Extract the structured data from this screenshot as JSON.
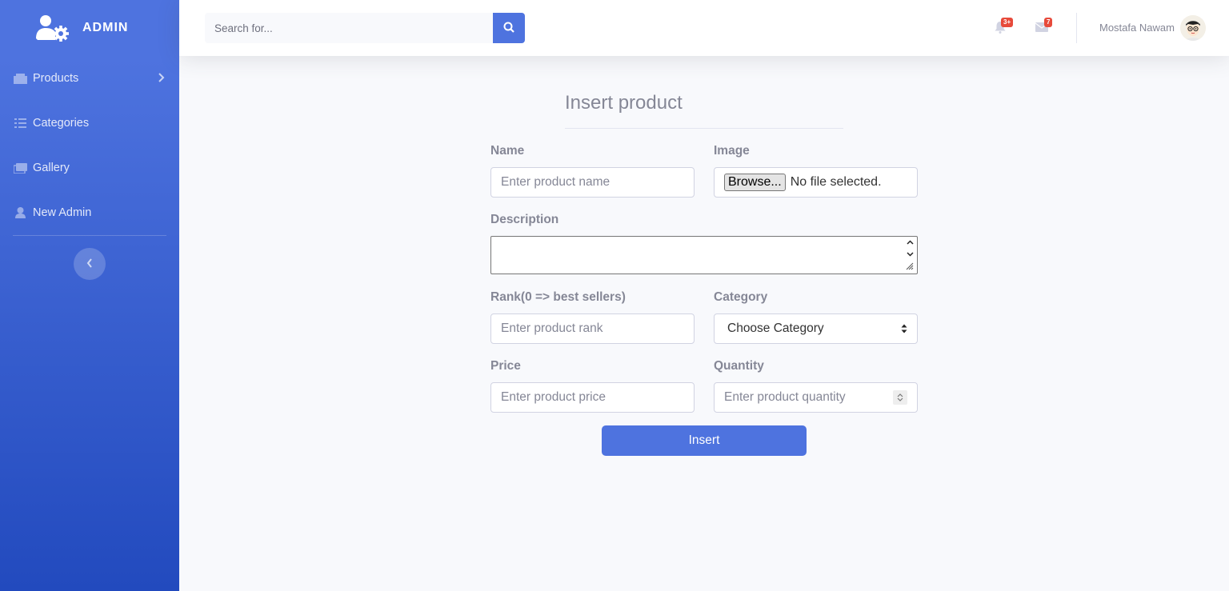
{
  "sidebar": {
    "brand": "ADMIN",
    "items": [
      {
        "label": "Products"
      },
      {
        "label": "Categories"
      },
      {
        "label": "Gallery"
      },
      {
        "label": "New Admin"
      }
    ]
  },
  "topbar": {
    "search_placeholder": "Search for...",
    "alerts_badge": "3+",
    "messages_badge": "7",
    "username": "Mostafa Nawam"
  },
  "form": {
    "title": "Insert product",
    "name_label": "Name",
    "name_placeholder": "Enter product name",
    "image_label": "Image",
    "browse_label": "Browse...",
    "file_status": "No file selected.",
    "description_label": "Description",
    "rank_label": "Rank(0 => best sellers)",
    "rank_placeholder": "Enter product rank",
    "category_label": "Category",
    "category_selected": "Choose Category",
    "price_label": "Price",
    "price_placeholder": "Enter product price",
    "quantity_label": "Quantity",
    "quantity_placeholder": "Enter product quantity",
    "submit_label": "Insert"
  },
  "colors": {
    "primary": "#4e73df",
    "sidebar_gradient_end": "#224abe",
    "badge": "#e74a3b",
    "background": "#f8f9fc"
  }
}
